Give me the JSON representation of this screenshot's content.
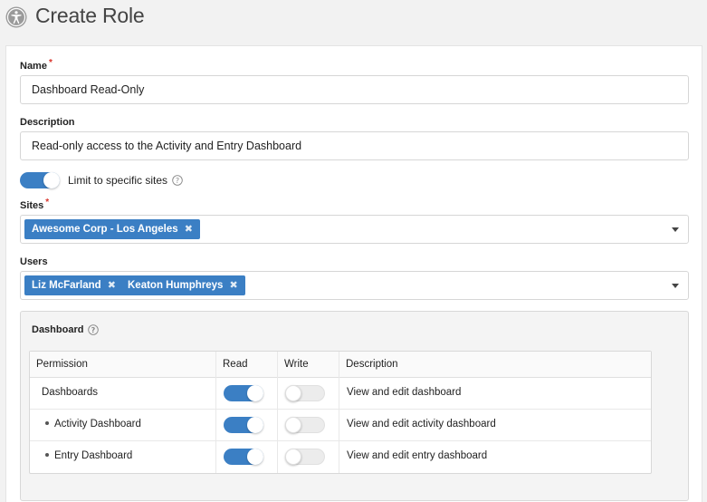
{
  "header": {
    "title": "Create Role",
    "icon": "accessibility-icon"
  },
  "form": {
    "name": {
      "label": "Name",
      "value": "Dashboard Read-Only",
      "required_mark": "*"
    },
    "description": {
      "label": "Description",
      "value": "Read-only access to the Activity and Entry Dashboard"
    },
    "limit_toggle": {
      "label": "Limit to specific sites",
      "state": "on"
    },
    "sites": {
      "label": "Sites",
      "required_mark": "*",
      "tags": [
        "Awesome Corp - Los Angeles"
      ]
    },
    "users": {
      "label": "Users",
      "tags": [
        "Liz McFarland",
        "Keaton Humphreys"
      ]
    },
    "tag_remove_glyph": "✖"
  },
  "permissions": {
    "section_title": "Dashboard",
    "columns": [
      "Permission",
      "Read",
      "Write",
      "Description"
    ],
    "rows": [
      {
        "permission": "Dashboards",
        "read": true,
        "write": false,
        "description": "View and edit dashboard",
        "child": false
      },
      {
        "permission": "Activity Dashboard",
        "read": true,
        "write": false,
        "description": "View and edit activity dashboard",
        "child": true
      },
      {
        "permission": "Entry Dashboard",
        "read": true,
        "write": false,
        "description": "View and edit entry dashboard",
        "child": true
      }
    ]
  },
  "colors": {
    "accent": "#3b7fc4",
    "required": "#d9342b"
  }
}
